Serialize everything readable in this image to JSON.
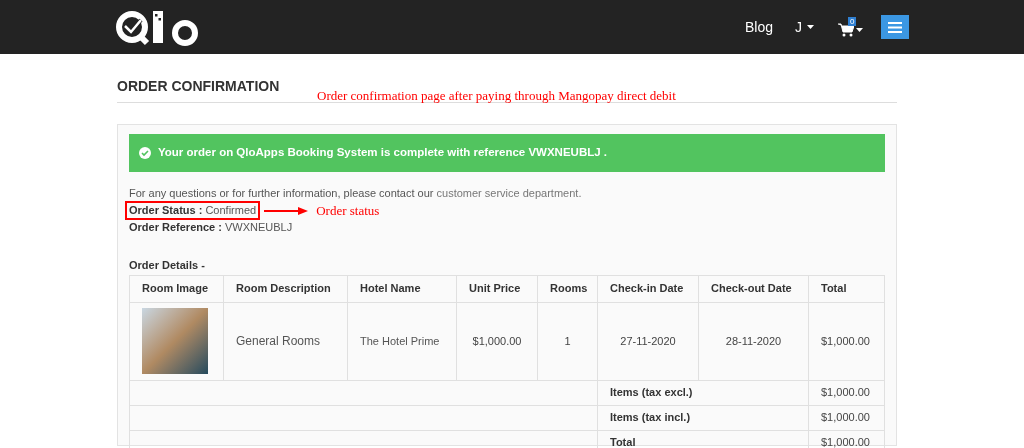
{
  "header": {
    "nav": [
      {
        "kind": "link",
        "label": "Blog"
      },
      {
        "kind": "dropdown",
        "label": "J"
      }
    ],
    "cart": {
      "count": "0"
    }
  },
  "page_title": "ORDER CONFIRMATION",
  "annotations": [
    {
      "kind": "note",
      "text": "Order confirmation page after paying through Mangopay direct debit"
    },
    {
      "kind": "arrow",
      "text": "Order status"
    }
  ],
  "alert": {
    "text": "Your order on QloApps Booking System is complete with reference VWXNEUBLJ ."
  },
  "info": {
    "text": "For any questions or for further information, please contact our",
    "link": "customer service department."
  },
  "order_status": {
    "label": "Order Status :",
    "value": "Confirmed",
    "highlighted": true
  },
  "order_reference": {
    "label": "Order Reference :",
    "value": "VWXNEUBLJ"
  },
  "order_details": {
    "title": "Order Details -",
    "columns": [
      "Room Image",
      "Room Description",
      "Hotel Name",
      "Unit Price",
      "Rooms",
      "Check-in Date",
      "Check-out Date",
      "Total"
    ],
    "rows": [
      {
        "room_description": "General Rooms",
        "hotel_name": "The Hotel Prime",
        "unit_price": "$1,000.00",
        "rooms": "1",
        "check_in": "27-11-2020",
        "check_out": "28-11-2020",
        "total": "$1,000.00"
      }
    ],
    "totals": [
      {
        "label": "Items (tax excl.)",
        "value": "$1,000.00"
      },
      {
        "label": "Items (tax incl.)",
        "value": "$1,000.00"
      },
      {
        "label": "Total",
        "value": "$1,000.00"
      }
    ]
  }
}
